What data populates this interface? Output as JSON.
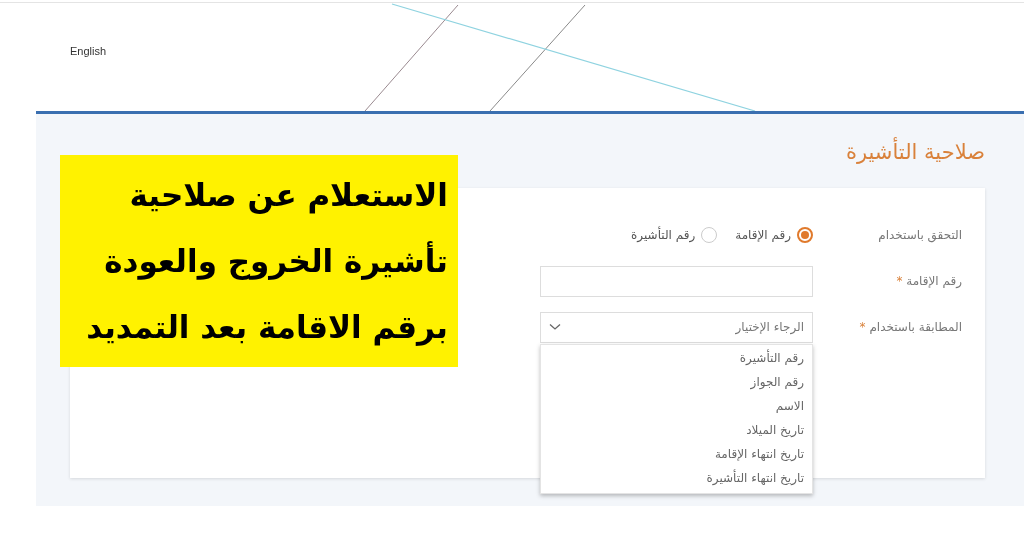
{
  "header": {
    "language_link": "English"
  },
  "page_title": "صلاحية التأشيرة",
  "form": {
    "verify_by": {
      "label": "التحقق باستخدام",
      "options": [
        {
          "label": "رقم الإقامة",
          "selected": true
        },
        {
          "label": "رقم التأشيرة",
          "selected": false
        }
      ]
    },
    "iqama": {
      "label": "رقم الإقامة",
      "mark": "*"
    },
    "match_by": {
      "label": "المطابقة باستخدام",
      "mark": "*",
      "placeholder": "الرجاء الإختيار",
      "expanded": true,
      "options": [
        "رقم التأشيرة",
        "رقم الجواز",
        "الاسم",
        "تاريخ الميلاد",
        "تاريخ انتهاء الإقامة",
        "تاريخ انتهاء التأشيرة"
      ]
    }
  },
  "banner": {
    "lines": [
      "الاستعلام عن صلاحية",
      "تأشيرة الخروج والعودة",
      "برقم الاقامة بعد التمديد"
    ]
  }
}
